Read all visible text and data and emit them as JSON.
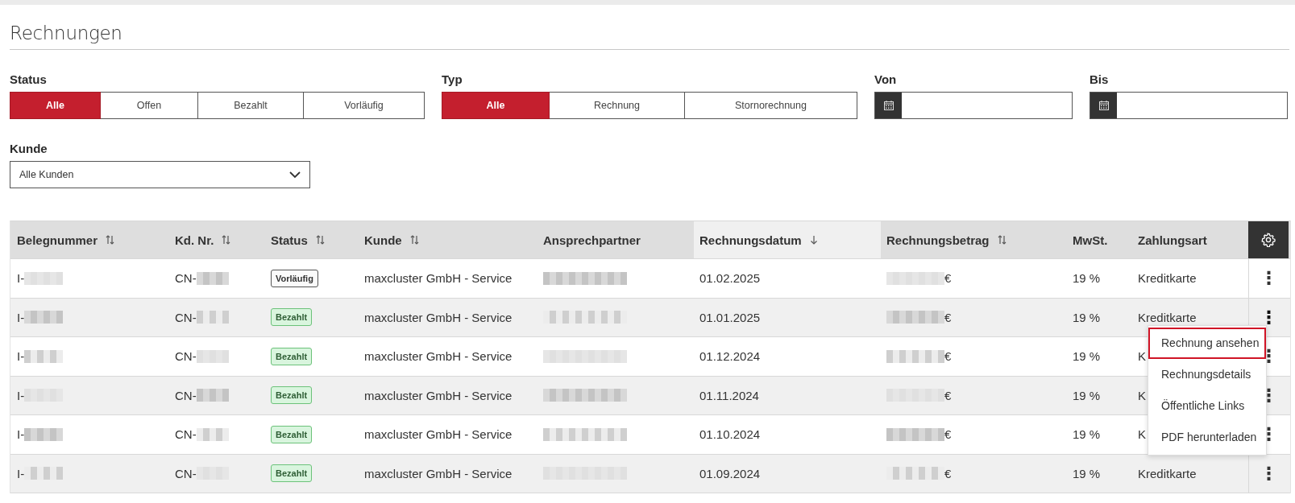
{
  "title": "Rechnungen",
  "filters": {
    "status": {
      "label": "Status",
      "options": [
        {
          "label": "Alle",
          "selected": true
        },
        {
          "label": "Offen",
          "selected": false
        },
        {
          "label": "Bezahlt",
          "selected": false
        },
        {
          "label": "Vorläufig",
          "selected": false
        }
      ]
    },
    "typ": {
      "label": "Typ",
      "options": [
        {
          "label": "Alle",
          "selected": true
        },
        {
          "label": "Rechnung",
          "selected": false
        },
        {
          "label": "Stornorechnung",
          "selected": false
        }
      ]
    },
    "von": {
      "label": "Von"
    },
    "bis": {
      "label": "Bis"
    },
    "kunde": {
      "label": "Kunde",
      "value": "Alle Kunden"
    }
  },
  "table": {
    "columns": [
      {
        "label": "Belegnummer",
        "sortable": true,
        "sorted": false,
        "redacted": true
      },
      {
        "label": "Kd. Nr.",
        "sortable": true,
        "sorted": false,
        "redacted": true
      },
      {
        "label": "Status",
        "sortable": true,
        "sorted": false
      },
      {
        "label": "Kunde",
        "sortable": true,
        "sorted": false
      },
      {
        "label": "Ansprechpartner",
        "sortable": false,
        "sorted": false,
        "redacted": true
      },
      {
        "label": "Rechnungsdatum",
        "sortable": true,
        "sorted": true
      },
      {
        "label": "Rechnungsbetrag",
        "sortable": true,
        "sorted": false,
        "redacted": true
      },
      {
        "label": "MwSt.",
        "sortable": false,
        "sorted": false
      },
      {
        "label": "Zahlungsart",
        "sortable": false,
        "sorted": false
      }
    ],
    "rows": [
      {
        "cells": [
          "I-",
          "CN-",
          {
            "label": "Vorläufig",
            "kind": "draft"
          },
          "maxcluster GmbH - Service",
          "",
          "01.02.2025",
          "€",
          "19 %",
          "Kreditkarte"
        ],
        "actions": "⋮",
        "menu_open": false
      },
      {
        "cells": [
          "I-",
          "CN-",
          {
            "label": "Bezahlt",
            "kind": "paid"
          },
          "maxcluster GmbH - Service",
          "",
          "01.01.2025",
          "€",
          "19 %",
          "Kreditkarte"
        ],
        "actions": "⋮",
        "menu_open": true
      },
      {
        "cells": [
          "I-",
          "CN-",
          {
            "label": "Bezahlt",
            "kind": "paid"
          },
          "maxcluster GmbH - Service",
          "",
          "01.12.2024",
          "€",
          "19 %",
          "K"
        ],
        "actions": "⋮",
        "menu_open": false
      },
      {
        "cells": [
          "I-",
          "CN-",
          {
            "label": "Bezahlt",
            "kind": "paid"
          },
          "maxcluster GmbH - Service",
          "",
          "01.11.2024",
          "€",
          "19 %",
          "K"
        ],
        "actions": "⋮",
        "menu_open": false
      },
      {
        "cells": [
          "I-",
          "CN-",
          {
            "label": "Bezahlt",
            "kind": "paid"
          },
          "maxcluster GmbH - Service",
          "",
          "01.10.2024",
          "€",
          "19 %",
          "K"
        ],
        "actions": "⋮",
        "menu_open": false
      },
      {
        "cells": [
          "I-",
          "CN-",
          {
            "label": "Bezahlt",
            "kind": "paid"
          },
          "maxcluster GmbH - Service",
          "",
          "01.09.2024",
          "€",
          "19 %",
          "Kreditkarte"
        ],
        "actions": "⋮",
        "menu_open": false
      }
    ]
  },
  "row_menu": {
    "items": [
      {
        "label": "Rechnung ansehen",
        "highlighted": true
      },
      {
        "label": "Rechnungsdetails",
        "highlighted": false
      },
      {
        "label": "Öffentliche Links",
        "highlighted": false
      },
      {
        "label": "PDF herunterladen",
        "highlighted": false
      }
    ]
  }
}
